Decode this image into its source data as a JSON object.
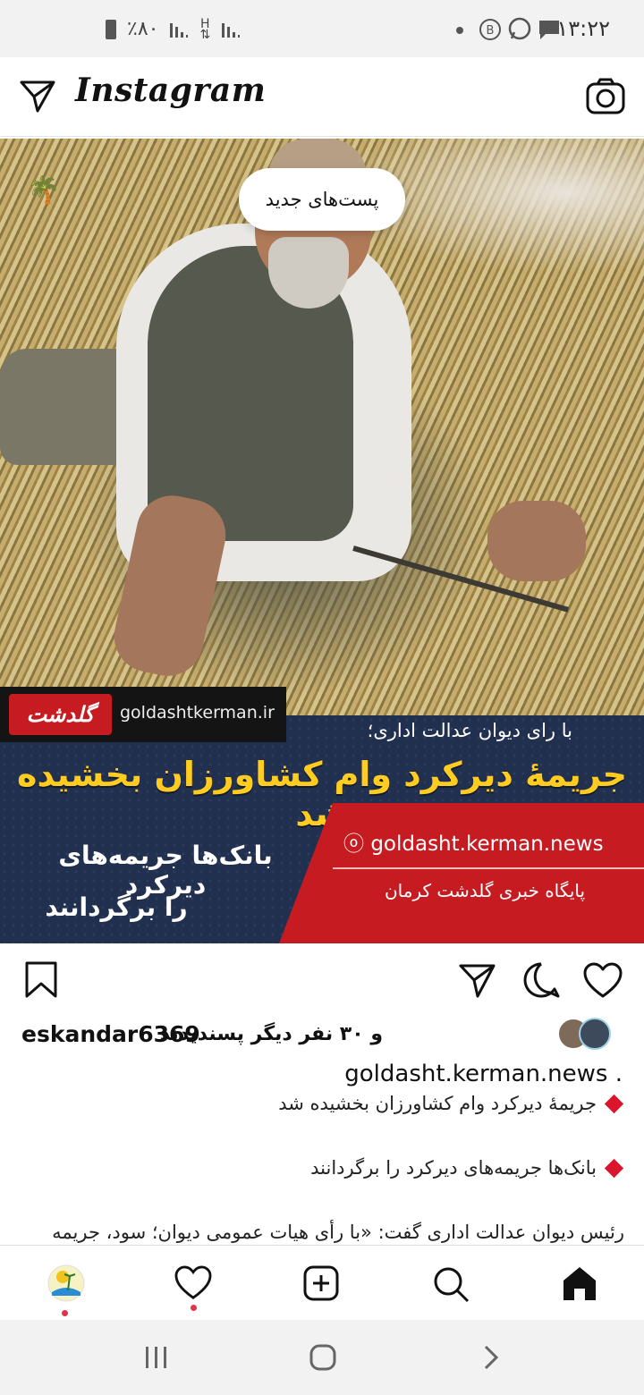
{
  "status_bar": {
    "time": "۱۳:۲۲",
    "battery_text": "٪۸۰",
    "net_h": "H",
    "icons": [
      "dot",
      "b-icon",
      "whatsapp-icon",
      "message-icon",
      "signal-icon",
      "signal-icon",
      "battery-icon"
    ]
  },
  "header": {
    "app_name": "Instagram",
    "icons": [
      "direct-send-icon",
      "camera-icon"
    ]
  },
  "post": {
    "new_posts_label": "پست‌های جدید",
    "image": {
      "site_url": "goldashtkerman.ir",
      "site_logo": "گلدشت",
      "subheadline": "با رای دیوان عدالت اداری؛",
      "headline": "جریمۀ دیرکرد وام کشاورزان بخشیده شد",
      "line1": "بانک‌ها جریمه‌های دیرکرد",
      "line2": "را برگردانند",
      "instagram_handle": "goldasht.kerman.news",
      "agency": "پایگاه خبری گلدشت کرمان"
    },
    "likes": {
      "user": "eskandar6369",
      "others_text": "و ۳۰ نفر دیگر پسندیدند"
    },
    "caption": {
      "username": "goldasht.kerman.news .",
      "line1": "جریمۀ دیرکرد وام کشاورزان بخشیده شد",
      "line2": "بانک‌ها جریمه‌های دیرکرد را برگردانند",
      "line3": "رئیس دیوان عدالت اداری گفت: «با رأی هیات عمومی دیوان؛ سود، جریمه"
    }
  },
  "bottom_nav": [
    "profile-avatar",
    "heart-icon",
    "add-post-icon",
    "search-icon",
    "home-icon"
  ],
  "system_nav": [
    "recents-icon",
    "home-circle-icon",
    "back-icon"
  ],
  "colors": {
    "accent_red": "#c71b22",
    "banner_blue": "#22304f",
    "headline_yellow": "#ffcc1f"
  }
}
